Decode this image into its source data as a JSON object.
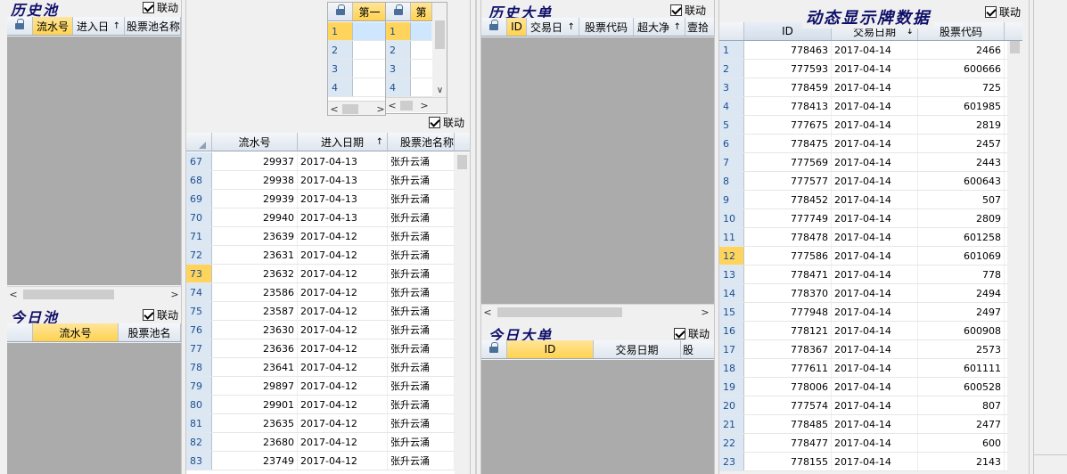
{
  "panels": {
    "hist_pool": {
      "title": "历史池",
      "link_label": "联动",
      "headers": [
        "流水号",
        "进入日",
        "股票池名称"
      ]
    },
    "today_pool": {
      "title": "今日池",
      "link_label": "联动",
      "headers": [
        "流水号",
        "股票池名"
      ]
    },
    "mini_grid_a": {
      "header": "第一",
      "rows": [
        "1",
        "2",
        "3",
        "4"
      ]
    },
    "mini_grid_b": {
      "header": "第",
      "rows": [
        "1",
        "2",
        "3",
        "4"
      ],
      "link_label": "联动"
    },
    "pool_detail": {
      "headers": [
        "流水号",
        "进入日期",
        "股票池名称"
      ],
      "rows": [
        {
          "n": "67",
          "id": "29937",
          "date": "2017-04-13",
          "name": "张升云涌"
        },
        {
          "n": "68",
          "id": "29938",
          "date": "2017-04-13",
          "name": "张升云涌"
        },
        {
          "n": "69",
          "id": "29939",
          "date": "2017-04-13",
          "name": "张升云涌"
        },
        {
          "n": "70",
          "id": "29940",
          "date": "2017-04-13",
          "name": "张升云涌"
        },
        {
          "n": "71",
          "id": "23639",
          "date": "2017-04-12",
          "name": "张升云涌"
        },
        {
          "n": "72",
          "id": "23631",
          "date": "2017-04-12",
          "name": "张升云涌"
        },
        {
          "n": "73",
          "id": "23632",
          "date": "2017-04-12",
          "name": "张升云涌"
        },
        {
          "n": "74",
          "id": "23586",
          "date": "2017-04-12",
          "name": "张升云涌"
        },
        {
          "n": "75",
          "id": "23587",
          "date": "2017-04-12",
          "name": "张升云涌"
        },
        {
          "n": "76",
          "id": "23630",
          "date": "2017-04-12",
          "name": "张升云涌"
        },
        {
          "n": "77",
          "id": "23636",
          "date": "2017-04-12",
          "name": "张升云涌"
        },
        {
          "n": "78",
          "id": "23641",
          "date": "2017-04-12",
          "name": "张升云涌"
        },
        {
          "n": "79",
          "id": "29897",
          "date": "2017-04-12",
          "name": "张升云涌"
        },
        {
          "n": "80",
          "id": "29901",
          "date": "2017-04-12",
          "name": "张升云涌"
        },
        {
          "n": "81",
          "id": "23635",
          "date": "2017-04-12",
          "name": "张升云涌"
        },
        {
          "n": "82",
          "id": "23680",
          "date": "2017-04-12",
          "name": "张升云涌"
        },
        {
          "n": "83",
          "id": "23749",
          "date": "2017-04-12",
          "name": "张升云涌"
        }
      ]
    },
    "hist_big": {
      "title": "历史大单",
      "link_label": "联动",
      "headers": [
        "ID",
        "交易日",
        "股票代码",
        "超大净",
        "壹拾"
      ]
    },
    "today_big": {
      "title": "今日大单",
      "link_label": "联动",
      "headers": [
        "ID",
        "交易日期",
        "股"
      ]
    },
    "dynamic": {
      "title": "动态显示牌数据",
      "link_label": "联动",
      "headers": [
        "ID",
        "交易日期",
        "股票代码"
      ],
      "rows": [
        {
          "n": "1",
          "id": "778463",
          "date": "2017-04-14",
          "code": "2466"
        },
        {
          "n": "2",
          "id": "777593",
          "date": "2017-04-14",
          "code": "600666"
        },
        {
          "n": "3",
          "id": "778459",
          "date": "2017-04-14",
          "code": "725"
        },
        {
          "n": "4",
          "id": "778413",
          "date": "2017-04-14",
          "code": "601985"
        },
        {
          "n": "5",
          "id": "777675",
          "date": "2017-04-14",
          "code": "2819"
        },
        {
          "n": "6",
          "id": "778475",
          "date": "2017-04-14",
          "code": "2457"
        },
        {
          "n": "7",
          "id": "777569",
          "date": "2017-04-14",
          "code": "2443"
        },
        {
          "n": "8",
          "id": "777577",
          "date": "2017-04-14",
          "code": "600643"
        },
        {
          "n": "9",
          "id": "778452",
          "date": "2017-04-14",
          "code": "507"
        },
        {
          "n": "10",
          "id": "777749",
          "date": "2017-04-14",
          "code": "2809"
        },
        {
          "n": "11",
          "id": "778478",
          "date": "2017-04-14",
          "code": "601258"
        },
        {
          "n": "12",
          "id": "777586",
          "date": "2017-04-14",
          "code": "601069"
        },
        {
          "n": "13",
          "id": "778471",
          "date": "2017-04-14",
          "code": "778"
        },
        {
          "n": "14",
          "id": "778370",
          "date": "2017-04-14",
          "code": "2494"
        },
        {
          "n": "15",
          "id": "777948",
          "date": "2017-04-14",
          "code": "2497"
        },
        {
          "n": "16",
          "id": "778121",
          "date": "2017-04-14",
          "code": "600908"
        },
        {
          "n": "17",
          "id": "778367",
          "date": "2017-04-14",
          "code": "2573"
        },
        {
          "n": "18",
          "id": "777611",
          "date": "2017-04-14",
          "code": "601111"
        },
        {
          "n": "19",
          "id": "778006",
          "date": "2017-04-14",
          "code": "600528"
        },
        {
          "n": "20",
          "id": "777574",
          "date": "2017-04-14",
          "code": "807"
        },
        {
          "n": "21",
          "id": "778485",
          "date": "2017-04-14",
          "code": "2477"
        },
        {
          "n": "22",
          "id": "778477",
          "date": "2017-04-14",
          "code": "600"
        },
        {
          "n": "23",
          "id": "778155",
          "date": "2017-04-14",
          "code": "2143"
        }
      ]
    }
  },
  "colors": {
    "selected_header": "#ffd24f",
    "row_number_bg": "#dce7f4",
    "empty_grid_bg": "#ababab",
    "title_color": "#10106a"
  }
}
